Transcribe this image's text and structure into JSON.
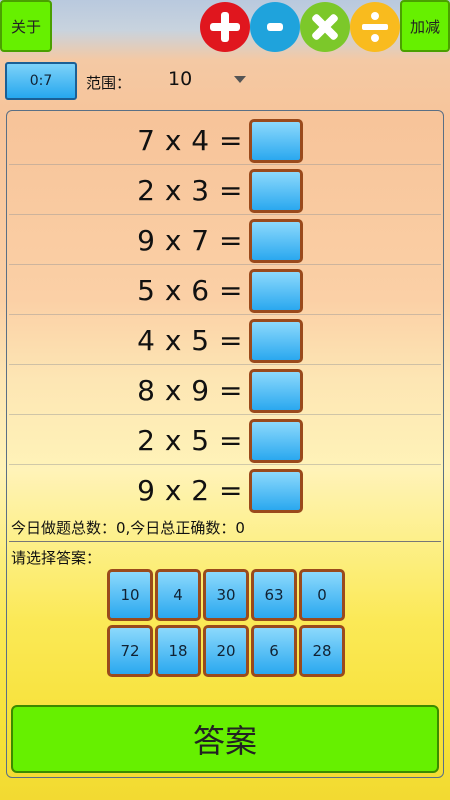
{
  "header": {
    "about_label": "关于",
    "mode_label": "加减",
    "operators": [
      {
        "name": "plus",
        "color": "#e0161e"
      },
      {
        "name": "minus",
        "color": "#1fa3dc"
      },
      {
        "name": "times",
        "color": "#7cc82a"
      },
      {
        "name": "divide",
        "color": "#f9bb1e"
      }
    ]
  },
  "controls": {
    "score": "0:7",
    "range_label": "范围：",
    "range_value": "10"
  },
  "questions": [
    {
      "text": "7 x 4 =",
      "answer": ""
    },
    {
      "text": "2 x 3 =",
      "answer": ""
    },
    {
      "text": "9 x 7 =",
      "answer": ""
    },
    {
      "text": "5 x 6 =",
      "answer": ""
    },
    {
      "text": "4 x 5 =",
      "answer": ""
    },
    {
      "text": "8 x 9 =",
      "answer": ""
    },
    {
      "text": "2 x 5 =",
      "answer": ""
    },
    {
      "text": "9 x 2 =",
      "answer": ""
    }
  ],
  "stats": "今日做题总数：0,今日总正确数：0",
  "choose_label": "请选择答案：",
  "choices": [
    [
      "10",
      "4",
      "30",
      "63",
      "0"
    ],
    [
      "72",
      "18",
      "20",
      "6",
      "28"
    ]
  ],
  "answer_button": "答案"
}
